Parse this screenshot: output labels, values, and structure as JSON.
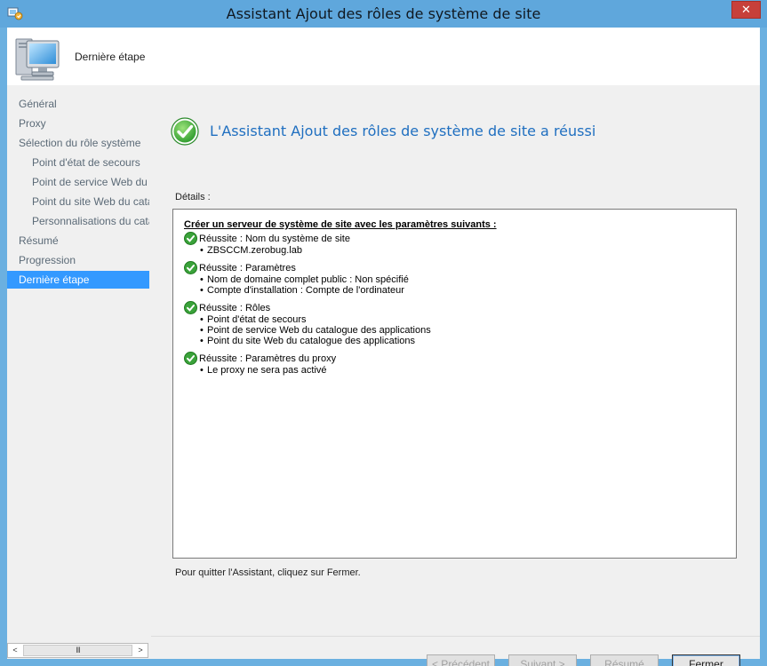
{
  "window": {
    "title": "Assistant Ajout des rôles de système de site",
    "close_label": "✕"
  },
  "header": {
    "title": "Dernière étape"
  },
  "nav": {
    "items": [
      {
        "label": "Général"
      },
      {
        "label": "Proxy"
      },
      {
        "label": "Sélection du rôle système"
      },
      {
        "label": "Point d'état de secours"
      },
      {
        "label": "Point de service Web du catalogue des applications"
      },
      {
        "label": "Point du site Web du catalogue des applications"
      },
      {
        "label": "Personnalisations du catalogue des applications"
      },
      {
        "label": "Résumé"
      },
      {
        "label": "Progression"
      },
      {
        "label": "Dernière étape"
      }
    ],
    "active_index": 9,
    "scroll": {
      "left_arrow": "<",
      "thumb_grip": "III",
      "right_arrow": ">"
    }
  },
  "main": {
    "success_title": "L'Assistant Ajout des rôles de système de site a réussi",
    "details_label": "Détails :",
    "details": {
      "heading": "Créer un serveur de système de site avec les paramètres suivants :",
      "groups": [
        {
          "title": "Réussite : Nom du système de site",
          "items": [
            "ZBSCCM.zerobug.lab"
          ]
        },
        {
          "title": "Réussite : Paramètres",
          "items": [
            "Nom de domaine complet public : Non spécifié",
            "Compte d'installation : Compte de l'ordinateur"
          ]
        },
        {
          "title": "Réussite : Rôles",
          "items": [
            "Point d'état de secours",
            "Point de service Web du catalogue des applications",
            "Point du site Web du catalogue des applications"
          ]
        },
        {
          "title": "Réussite : Paramètres du proxy",
          "items": [
            "Le proxy ne sera pas activé"
          ]
        }
      ]
    },
    "quit_text": "Pour quitter l'Assistant, cliquez sur Fermer."
  },
  "buttons": {
    "previous": "< Précédent",
    "next": "Suivant >",
    "summary": "Résumé",
    "close": "Fermer"
  },
  "colors": {
    "titlebar": "#5fa7dc",
    "accent_selected": "#3399ff",
    "success_title": "#1f6fc0",
    "close_button": "#c7403a"
  }
}
